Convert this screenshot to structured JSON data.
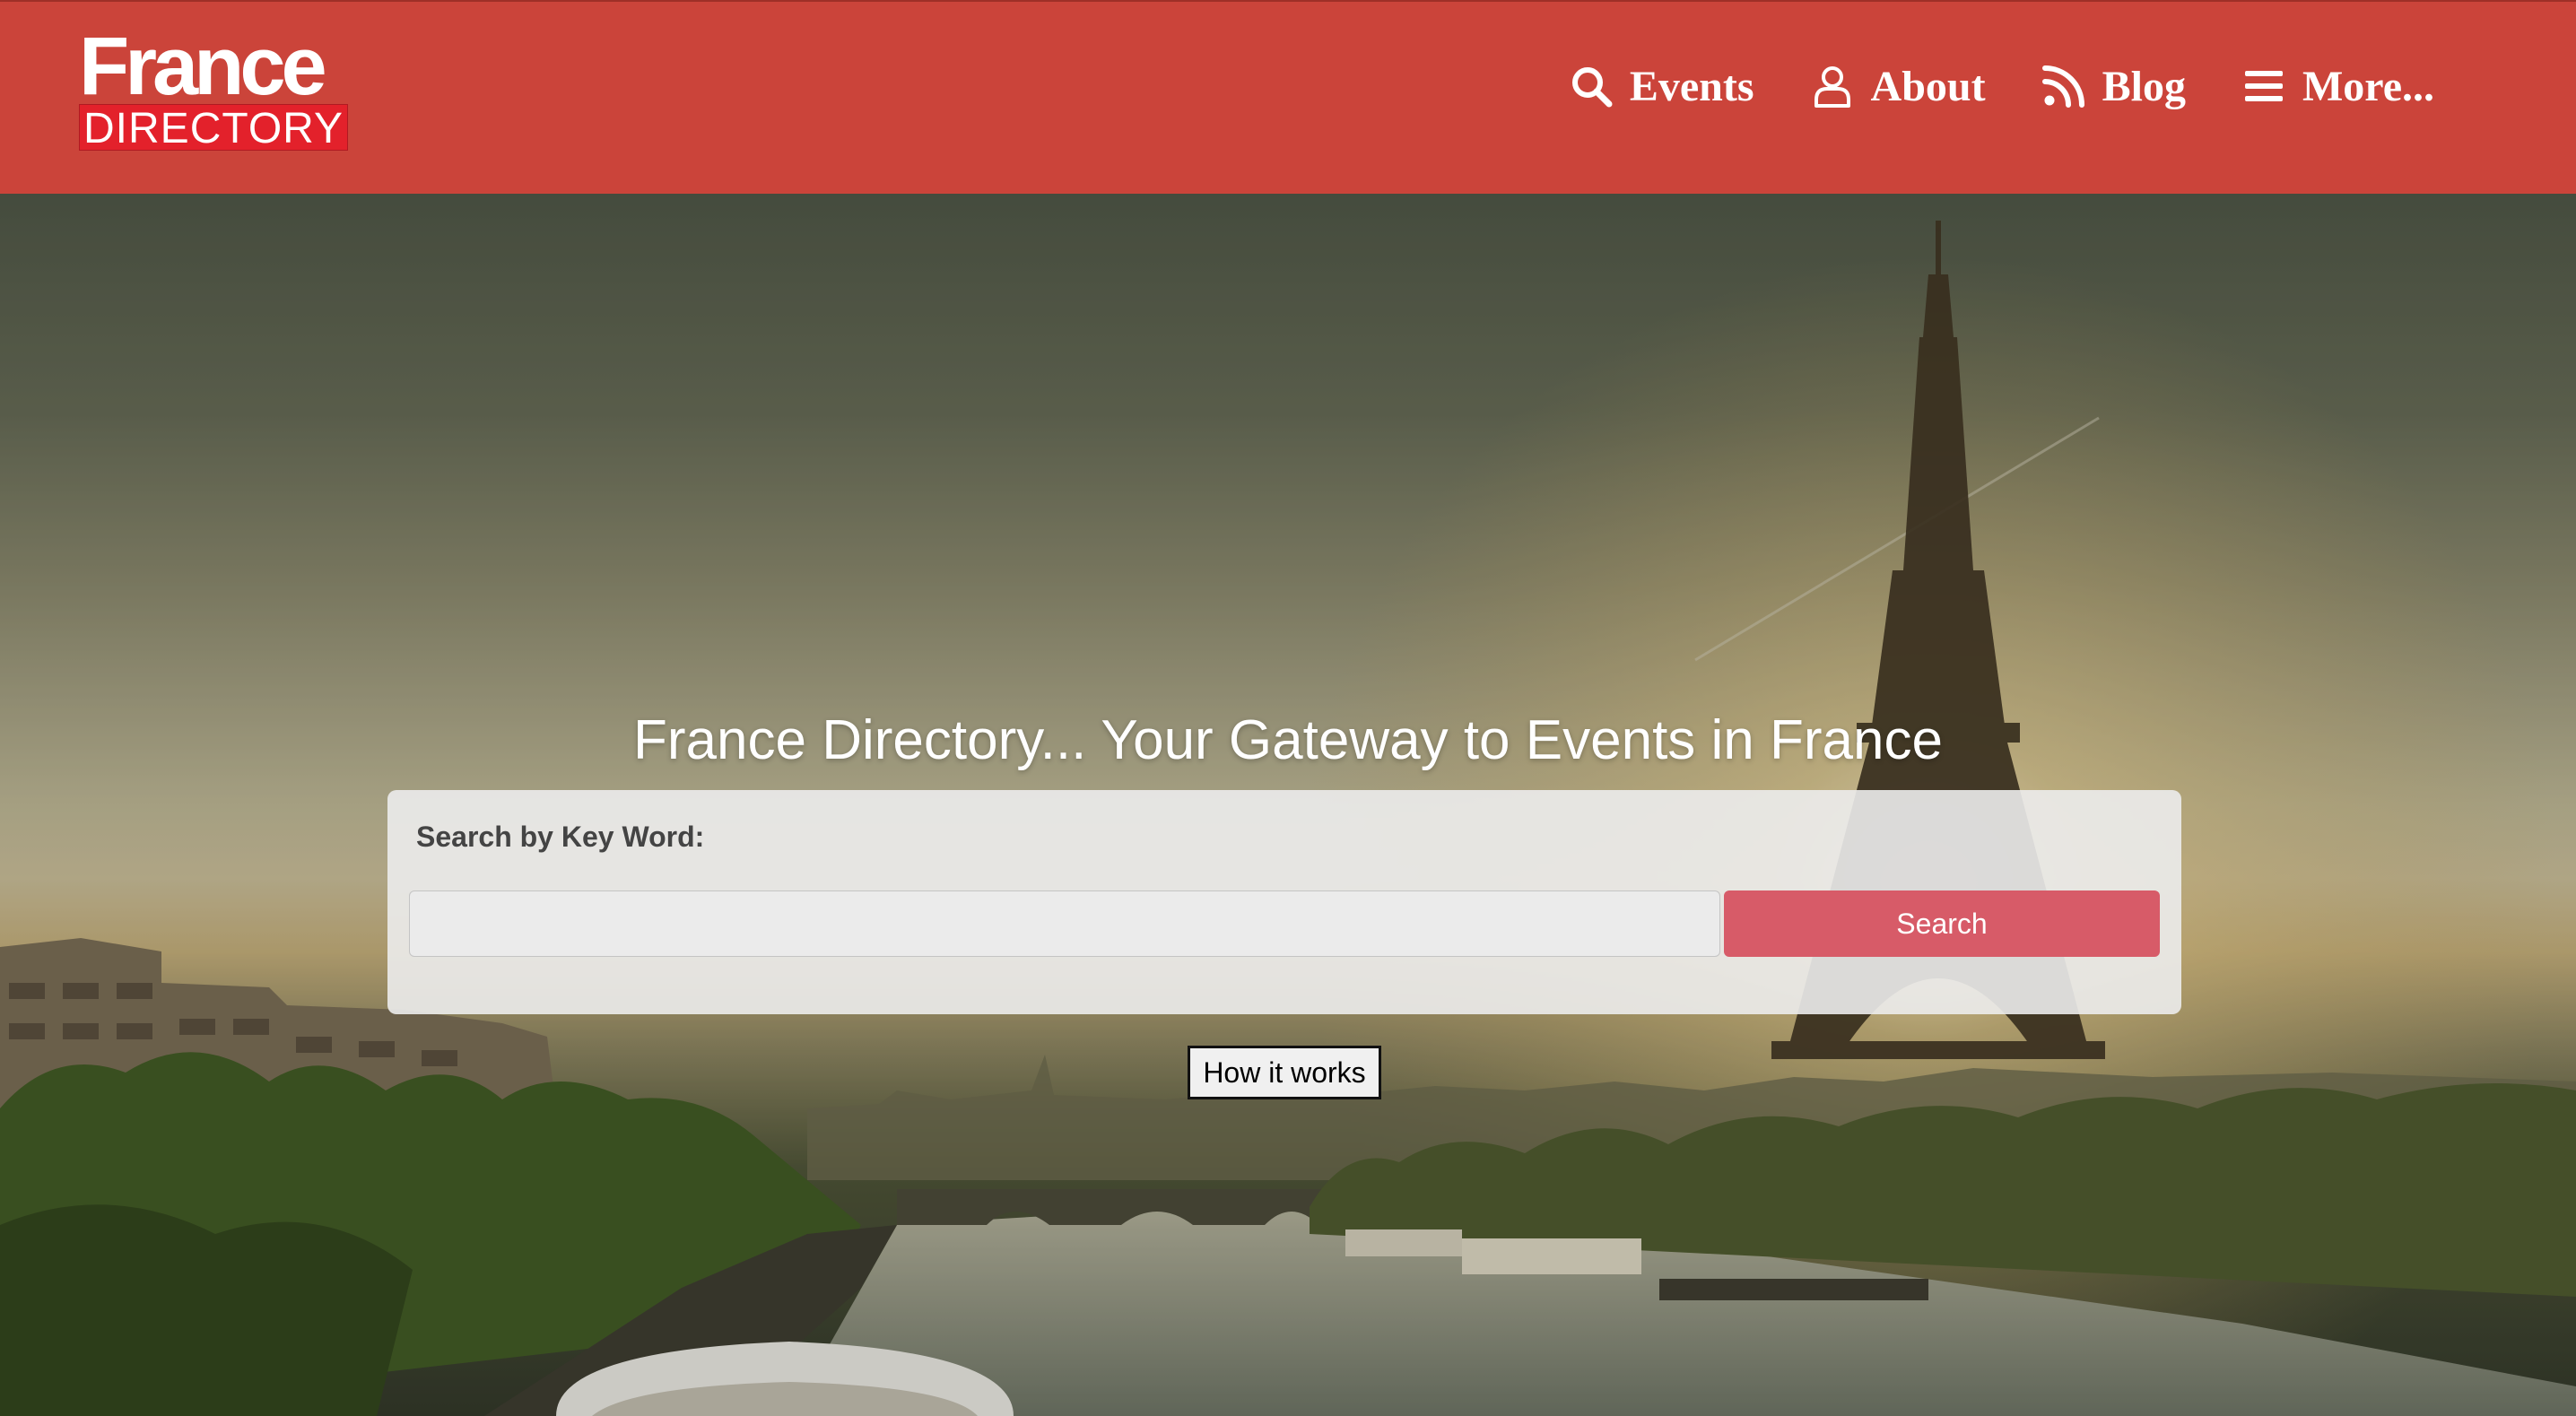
{
  "header": {
    "logo": {
      "line1": "France",
      "line2": "DIRECTORY"
    },
    "nav": [
      {
        "label": "Events",
        "icon": "search-icon"
      },
      {
        "label": "About",
        "icon": "user-icon"
      },
      {
        "label": "Blog",
        "icon": "rss-icon"
      },
      {
        "label": "More...",
        "icon": "menu-icon"
      }
    ],
    "colors": {
      "header_bg": "#cb443a",
      "logo_box": "#e3212b"
    }
  },
  "hero": {
    "title": "France Directory... Your Gateway to Events in France",
    "background": "photo of the Eiffel Tower and the Seine at sunset"
  },
  "search": {
    "label": "Search by Key Word:",
    "value": "",
    "placeholder": "",
    "button_label": "Search",
    "button_color": "#d75b68"
  },
  "how_it_works": {
    "label": "How it works"
  }
}
